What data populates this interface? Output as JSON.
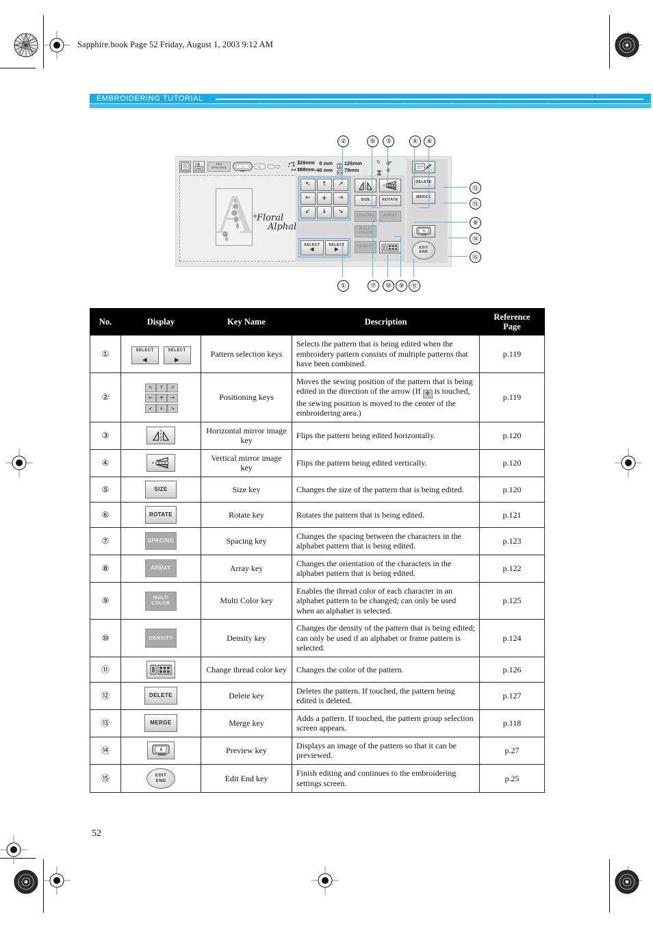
{
  "document": {
    "filestamp": "Sapphire.book  Page 52  Friday, August 1, 2003  9:12 AM",
    "banner_title": "EMBROIDERING TUTORIAL",
    "page_number": "52",
    "banner_color": "#18ade8",
    "banner_color_light": "#3dbdf0"
  },
  "figure": {
    "toolbar": {
      "new_embroidery_label_line1": "New",
      "new_embroidery_label_line2": "Embroidery",
      "icons": [
        "settings-list-icon",
        "help-print-icon",
        "hoop-selection-icon"
      ],
      "hoop_height": "126mm",
      "hoop_width": "188mm"
    },
    "info": {
      "vertical_position": "0 mm",
      "horizontal_position": "-40 mm",
      "pattern_height": "126mm",
      "pattern_width": "79mm",
      "rotation": "0°",
      "color_count": "6"
    },
    "preview": {
      "letter": "A",
      "script_line1": "Floral",
      "script_line2": "Alphabet"
    },
    "keys": {
      "arrows": [
        "↖",
        "↑",
        "↗",
        "←",
        "✛",
        "→",
        "↙",
        "↓",
        "↘"
      ],
      "select_left": "SELECT",
      "select_left_arrow": "◀",
      "select_right": "SELECT",
      "select_right_arrow": "▶",
      "size": "SIZE",
      "rotate": "ROTATE",
      "spacing": "SPACING",
      "array": "ARRAY",
      "multi_color_line1": "MULTI",
      "multi_color_line2": "COLOR",
      "density": "DENSITY",
      "delete": "DELETE",
      "merge": "MERGE",
      "edit_end_line1": "EDIT",
      "edit_end_line2": "END"
    },
    "callouts": {
      "top": [
        "②",
        "⑤",
        "③",
        "④",
        "⑥"
      ],
      "right": [
        "⑫",
        "⑬",
        "⑧",
        "⑭",
        "⑮"
      ],
      "bottom": [
        "①",
        "⑦",
        "⑩",
        "⑨",
        "⑪"
      ]
    }
  },
  "table": {
    "headers": [
      "No.",
      "Display",
      "Key Name",
      "Description",
      "Reference\nPage"
    ],
    "header_no": "No.",
    "header_display": "Display",
    "header_keyname": "Key Name",
    "header_description": "Description",
    "header_ref_line1": "Reference",
    "header_ref_line2": "Page",
    "rows": [
      {
        "no": "①",
        "display": "select-keys",
        "key_name": "Pattern selection keys",
        "description": "Selects the pattern that is being edited when the embroidery pattern consists of multiple patterns that have been combined.",
        "ref": "p.119"
      },
      {
        "no": "②",
        "display": "positioning-pad",
        "key_name": "Positioning keys",
        "description_part1": "Moves the sewing position of the pattern that is being edited in the direction of the arrow (If",
        "description_part2": "is touched, the sewing position is moved to the center of the embroidering area.)",
        "ref": "p.119"
      },
      {
        "no": "③",
        "display": "horizontal-mirror-key",
        "key_name": "Horizontal mirror image key",
        "description": "Flips the pattern being edited horizontally.",
        "ref": "p.120"
      },
      {
        "no": "④",
        "display": "vertical-mirror-key",
        "key_name": "Vertical mirror image key",
        "description": "Flips the pattern being edited vertically.",
        "ref": "p.120"
      },
      {
        "no": "⑤",
        "display": "SIZE",
        "key_name": "Size key",
        "description": "Changes the size of the pattern that is being edited.",
        "ref": "p.120"
      },
      {
        "no": "⑥",
        "display": "ROTATE",
        "key_name": "Rotate key",
        "description": "Rotates the pattern that is being edited.",
        "ref": "p.121"
      },
      {
        "no": "⑦",
        "display": "SPACING",
        "key_name": "Spacing key",
        "description": "Changes the spacing between the characters in the alphabet pattern that is being edited.",
        "ref": "p.123"
      },
      {
        "no": "⑧",
        "display": "ARRAY",
        "key_name": "Array key",
        "description": "Changes the orientation of the characters in the alphabet pattern that is being edited.",
        "ref": "p.122"
      },
      {
        "no": "⑨",
        "display": "MULTI COLOR",
        "key_name": "Multi Color key",
        "description": "Enables the thread color of each character in an alphabet pattern to be changed; can only be used when an alphabet is selected.",
        "ref": "p.125"
      },
      {
        "no": "⑩",
        "display": "DENSITY",
        "key_name": "Density key",
        "description": "Changes the density of the pattern that is being edited; can only be used if an alphabet or frame pattern is selected.",
        "ref": "p.124"
      },
      {
        "no": "⑪",
        "display": "change-thread-color-icon",
        "key_name": "Change thread color key",
        "description": "Changes the color of the pattern.",
        "ref": "p.126"
      },
      {
        "no": "⑫",
        "display": "DELETE",
        "key_name": "Delete key",
        "description": "Deletes the pattern. If touched, the pattern being edited is deleted.",
        "ref": "p.127"
      },
      {
        "no": "⑬",
        "display": "MERGE",
        "key_name": "Merge key",
        "description": "Adds a pattern. If touched, the pattern group selection screen appears.",
        "ref": "p.118"
      },
      {
        "no": "⑭",
        "display": "preview-icon",
        "key_name": "Preview key",
        "description": "Displays an image of the pattern so that it can be previewed.",
        "ref": "p.27"
      },
      {
        "no": "⑮",
        "display": "EDIT END",
        "key_name": "Edit End key",
        "description": "Finish editing and continues to the embroidering settings screen.",
        "ref": "p.25"
      }
    ]
  }
}
